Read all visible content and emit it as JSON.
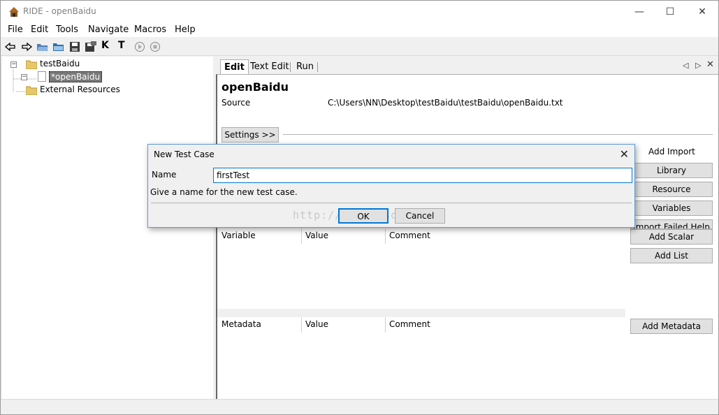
{
  "window": {
    "title": "RIDE - openBaidu",
    "minimize": "—",
    "maximize": "☐",
    "close": "✕"
  },
  "menu": [
    "File",
    "Edit",
    "Tools",
    "Navigate",
    "Macros",
    "Help"
  ],
  "toolbar": {
    "icons": [
      "back-arrow-icon",
      "forward-arrow-icon",
      "open-suite-icon",
      "open-directory-icon",
      "save-icon",
      "save-all-icon",
      "search-keywords-icon",
      "search-tests-icon",
      "run-icon",
      "stop-icon"
    ],
    "keyword_search_label": "K",
    "test_search_label": "T"
  },
  "tree": {
    "root": "testBaidu",
    "child": "*openBaidu",
    "external": "External Resources"
  },
  "tabs": [
    "Edit",
    "Text Edit",
    "Run"
  ],
  "editor": {
    "title": "openBaidu",
    "source_label": "Source",
    "source_path": "C:\\Users\\NN\\Desktop\\testBaidu\\testBaidu\\openBaidu.txt",
    "settings_button": "Settings >>",
    "add_import_label": "Add Import",
    "library_button": "Library",
    "resource_button": "Resource",
    "variables_button": "Variables",
    "import_failed_button": "Import Failed Help",
    "variable_header": "Variable",
    "value_header": "Value",
    "comment_header": "Comment",
    "add_scalar_button": "Add Scalar",
    "add_list_button": "Add List",
    "metadata_header": "Metadata",
    "metadata_value_header": "Value",
    "metadata_comment_header": "Comment",
    "add_metadata_button": "Add Metadata"
  },
  "dialog": {
    "title": "New Test Case",
    "name_label": "Name",
    "name_value": "firstTest",
    "hint": "Give a name for the new test case.",
    "ok": "OK",
    "cancel": "Cancel",
    "watermark": "http://blog.csdn.net/"
  }
}
